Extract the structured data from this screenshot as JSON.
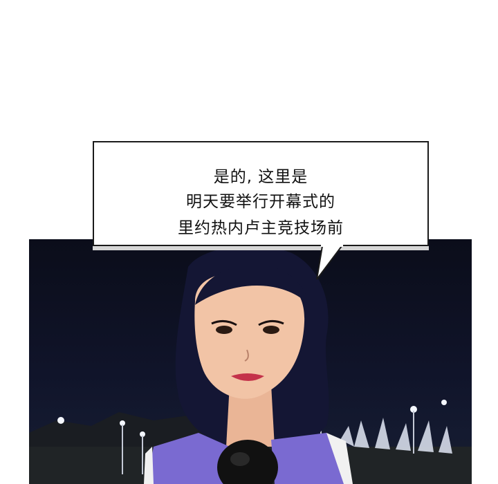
{
  "speech_bubble": {
    "lines": [
      "是的, 这里是",
      "明天要举行开幕式的",
      "里约热内卢主竞技场前"
    ]
  },
  "scene": {
    "characters": [
      "reporter"
    ],
    "props": [
      "microphone"
    ],
    "setting": [
      "night-sky",
      "stadium-lights",
      "hills"
    ]
  },
  "colors": {
    "night_sky": "#0b0d1a",
    "hair": "#141634",
    "skin": "#f2c4a6",
    "lips": "#c4324a",
    "top": "#7a6ad1",
    "bubble_border": "#1a1a1a"
  }
}
